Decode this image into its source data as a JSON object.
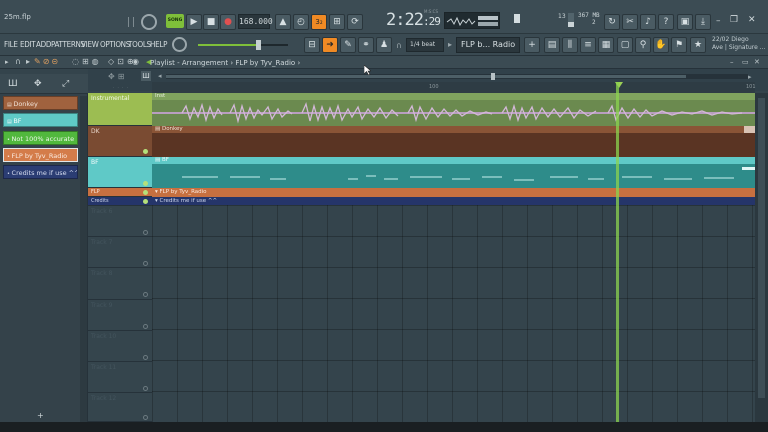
{
  "app": {
    "file_name": "25m.flp"
  },
  "transport": {
    "mode_label": "SONG",
    "bpm": "168.000",
    "time": "2:22",
    "time_small": "29",
    "time_unit": "M:S:CS",
    "cpu": "367 MB",
    "cpu_sub": "2",
    "polyphony": "13",
    "snap": "1/4 beat",
    "pattern": "FLP b... Radio",
    "hint_line1": "22/02  Diego",
    "hint_line2": "Ave | Signature ..."
  },
  "menu": [
    "FILE",
    "EDIT",
    "ADD",
    "PATTERNS",
    "VIEW",
    "OPTIONS",
    "TOOLS",
    "HELP"
  ],
  "breadcrumb": {
    "part1": "Playlist",
    "sep": "-",
    "part2": "Arrangement",
    "arrow": "›",
    "part3": "FLP by Tyv_Radio",
    "arrow2": "›"
  },
  "ruler": {
    "mark_mid": "100",
    "mark_end": "101"
  },
  "picker": [
    {
      "label": "Donkey",
      "color": "#a0623e"
    },
    {
      "label": "BF",
      "color": "#5fc9c7"
    },
    {
      "label": "Not 100% accurate",
      "color": "#51b83d"
    },
    {
      "label": "FLP by Tyv_Radio",
      "color": "#d47c4a"
    },
    {
      "label": "Credits me if use ^^",
      "color": "#2b3d73"
    }
  ],
  "tracks": [
    {
      "name": "Instrumental",
      "clip": "Inst",
      "color": "#9cbd52"
    },
    {
      "name": "DK",
      "clip": "Donkey",
      "color": "#8a5436"
    },
    {
      "name": "BF",
      "clip": "BF",
      "color": "#5fc9c7"
    },
    {
      "name": "FLP",
      "clip": "FLP by Tyv_Radio",
      "color": "#c77040"
    },
    {
      "name": "Credits",
      "clip": "Credits me if use ^^",
      "color": "#25356a"
    },
    {
      "name": "Track 6"
    },
    {
      "name": "Track 7"
    },
    {
      "name": "Track 8"
    },
    {
      "name": "Track 9"
    },
    {
      "name": "Track 10"
    },
    {
      "name": "Track 11"
    },
    {
      "name": "Track 12"
    }
  ],
  "playhead_position": 0.77,
  "picker_add": "+"
}
